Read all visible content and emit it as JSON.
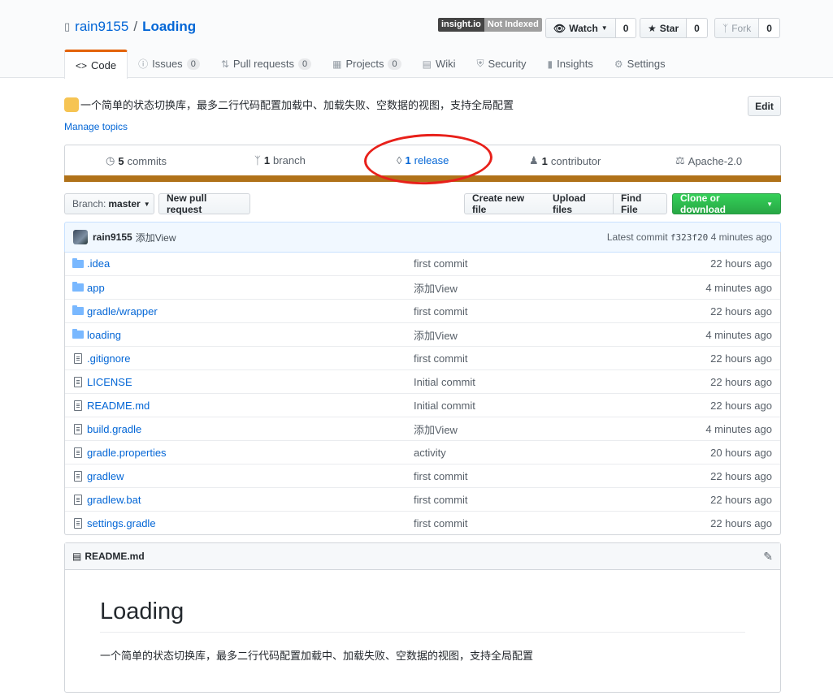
{
  "repo": {
    "owner": "rain9155",
    "separator": "/",
    "name": "Loading"
  },
  "insight": {
    "label": "insight.io",
    "status": "Not Indexed"
  },
  "actions": [
    {
      "label": "Watch",
      "count": "0"
    },
    {
      "label": "Star",
      "count": "0"
    },
    {
      "label": "Fork",
      "count": "0"
    }
  ],
  "tabs": [
    {
      "label": "Code"
    },
    {
      "label": "Issues",
      "count": "0"
    },
    {
      "label": "Pull requests",
      "count": "0"
    },
    {
      "label": "Projects",
      "count": "0"
    },
    {
      "label": "Wiki"
    },
    {
      "label": "Security"
    },
    {
      "label": "Insights"
    },
    {
      "label": "Settings"
    }
  ],
  "description": "一个简单的状态切换库，最多二行代码配置加载中、加载失败、空数据的视图，支持全局配置",
  "manage_topics": "Manage topics",
  "edit_label": "Edit",
  "summary": {
    "commits": {
      "count": "5",
      "label": "commits"
    },
    "branches": {
      "count": "1",
      "label": "branch"
    },
    "releases": {
      "count": "1",
      "label": "release"
    },
    "contributors": {
      "count": "1",
      "label": "contributor"
    },
    "license": "Apache-2.0"
  },
  "language_color": "#b07219",
  "annotation_color": "#e8201a",
  "toolbar": {
    "branch_prefix": "Branch:",
    "branch": "master",
    "new_pr": "New pull request",
    "create_file": "Create new file",
    "upload_files": "Upload files",
    "find_file": "Find File",
    "clone": "Clone or download"
  },
  "latest_commit": {
    "author": "rain9155",
    "message": "添加View",
    "prefix": "Latest commit",
    "sha": "f323f20",
    "age": "4 minutes ago"
  },
  "files": [
    {
      "type": "folder",
      "name": ".idea",
      "message": "first commit",
      "age": "22 hours ago"
    },
    {
      "type": "folder",
      "name": "app",
      "message": "添加View",
      "age": "4 minutes ago"
    },
    {
      "type": "folder",
      "name": "gradle/wrapper",
      "message": "first commit",
      "age": "22 hours ago"
    },
    {
      "type": "folder",
      "name": "loading",
      "message": "添加View",
      "age": "4 minutes ago"
    },
    {
      "type": "file",
      "name": ".gitignore",
      "message": "first commit",
      "age": "22 hours ago"
    },
    {
      "type": "file",
      "name": "LICENSE",
      "message": "Initial commit",
      "age": "22 hours ago"
    },
    {
      "type": "file",
      "name": "README.md",
      "message": "Initial commit",
      "age": "22 hours ago"
    },
    {
      "type": "file",
      "name": "build.gradle",
      "message": "添加View",
      "age": "4 minutes ago"
    },
    {
      "type": "file",
      "name": "gradle.properties",
      "message": "activity",
      "age": "20 hours ago"
    },
    {
      "type": "file",
      "name": "gradlew",
      "message": "first commit",
      "age": "22 hours ago"
    },
    {
      "type": "file",
      "name": "gradlew.bat",
      "message": "first commit",
      "age": "22 hours ago"
    },
    {
      "type": "file",
      "name": "settings.gradle",
      "message": "first commit",
      "age": "22 hours ago"
    }
  ],
  "readme": {
    "filename": "README.md",
    "heading": "Loading",
    "body": "一个简单的状态切换库，最多二行代码配置加载中、加载失败、空数据的视图，支持全局配置"
  }
}
